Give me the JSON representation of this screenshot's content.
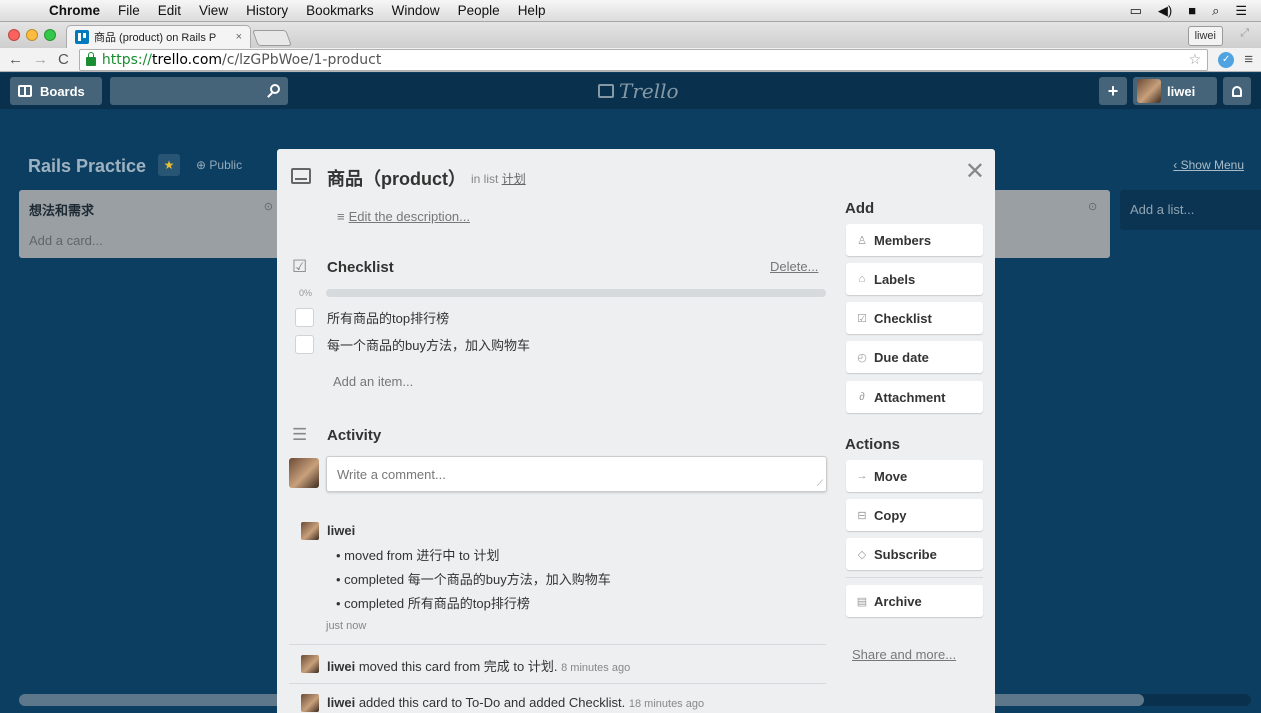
{
  "os_menu": {
    "app": "Chrome",
    "items": [
      "File",
      "Edit",
      "View",
      "History",
      "Bookmarks",
      "Window",
      "People",
      "Help"
    ]
  },
  "browser": {
    "tab_title": "商品 (product) on Rails P",
    "tab_close": "×",
    "profile": "liwei",
    "url_scheme": "https://",
    "url_host": "trello.com",
    "url_path": "/c/lzGPbWoe/1-product"
  },
  "trello_header": {
    "boards_label": "Boards",
    "logo_text": "Trello",
    "add_label": "+",
    "member_name": "liwei"
  },
  "board": {
    "title": "Rails Practice",
    "visibility": "Public",
    "show_menu": "Show Menu",
    "lists": [
      {
        "name": "想法和需求",
        "add_card": "Add a card..."
      }
    ],
    "add_list": "Add a list..."
  },
  "card": {
    "title": "商品（product）",
    "in_list_prefix": "in list",
    "list_name": "计划",
    "edit_description": "Edit the description...",
    "checklist": {
      "title": "Checklist",
      "delete_label": "Delete...",
      "progress_text": "0%",
      "progress_value": 0,
      "items": [
        {
          "text": "所有商品的top排行榜",
          "checked": false
        },
        {
          "text": "每一个商品的buy方法，加入购物车",
          "checked": false
        }
      ],
      "add_item": "Add an item..."
    },
    "activity": {
      "title": "Activity",
      "comment_placeholder": "Write a comment...",
      "group_user": "liwei",
      "group_items": [
        "moved from 进行中 to 计划",
        "completed 每一个商品的buy方法，加入购物车",
        "completed 所有商品的top排行榜"
      ],
      "group_time": "just now",
      "entries": [
        {
          "user": "liwei",
          "text": "moved this card from 完成 to 计划.",
          "time": "8 minutes ago"
        },
        {
          "user": "liwei",
          "text": "added this card to To-Do and added Checklist.",
          "time": "18 minutes ago"
        }
      ]
    },
    "sidebar": {
      "add_heading": "Add",
      "add_buttons": [
        {
          "label": "Members",
          "icon": "person-icon"
        },
        {
          "label": "Labels",
          "icon": "tag-icon"
        },
        {
          "label": "Checklist",
          "icon": "checkbox-icon"
        },
        {
          "label": "Due date",
          "icon": "clock-icon"
        },
        {
          "label": "Attachment",
          "icon": "paperclip-icon"
        }
      ],
      "actions_heading": "Actions",
      "action_buttons": [
        {
          "label": "Move",
          "icon": "arrow-right-icon"
        },
        {
          "label": "Copy",
          "icon": "card-icon"
        },
        {
          "label": "Subscribe",
          "icon": "eye-icon"
        },
        {
          "label": "Archive",
          "icon": "archive-icon"
        }
      ],
      "share_more": "Share and more..."
    }
  },
  "colors": {
    "board_bg": "#0c3e61",
    "header_bg": "#09304c",
    "dialog_bg": "#edeff0",
    "list_bg": "#9a9fa3",
    "url_green": "#1a8e32"
  }
}
